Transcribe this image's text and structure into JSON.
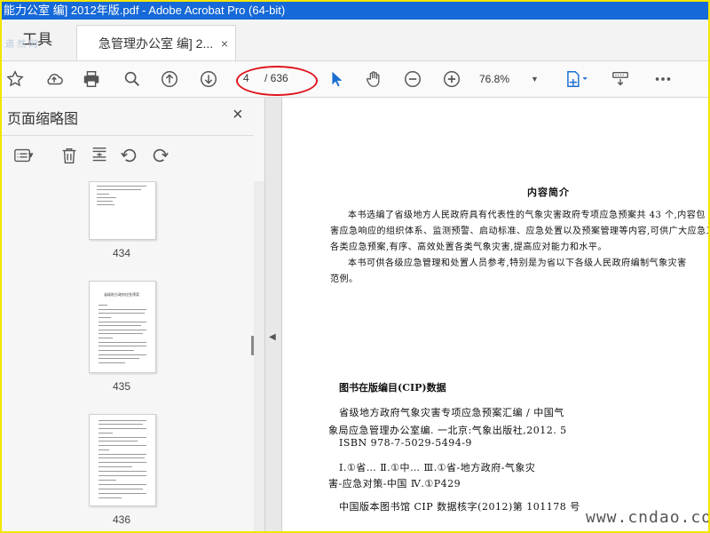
{
  "window": {
    "title": "能力公室 编] 2012年版.pdf - Adobe Acrobat Pro (64-bit)"
  },
  "tabs": {
    "tools_label": "工具",
    "watermark": "道 然 网",
    "doc_tab_label": "急管理办公室 编] 2...",
    "doc_tab_close": "×"
  },
  "toolbar": {
    "page_current": "4",
    "page_total": "/ 636",
    "zoom": "76.8%",
    "zoom_caret": "▼"
  },
  "panel": {
    "title": "页面缩略图",
    "close": "×",
    "options_caret": "▾",
    "thumbnails": [
      {
        "label": "434",
        "heading": ""
      },
      {
        "label": "435",
        "heading": "省级地方政府应急预案"
      },
      {
        "label": "436",
        "heading": ""
      }
    ],
    "collapse_arrow": "◀"
  },
  "document": {
    "intro_title": "内容简介",
    "intro_lines": [
      "本书选编了省级地方人民政府具有代表性的气象灾害政府专项应急预案共 43 个,内容包",
      "害应急响应的组织体系、监测预警、启动标准、应急处置以及预案管理等内容,可供广大应急工",
      "各类应急预案,有序、高效处置各类气象灾害,提高应对能力和水平。",
      "本书可供各级应急管理和处置人员参考,特别是为省以下各级人民政府编制气象灾害",
      "范例。"
    ],
    "cip_title": "图书在版编目(CIP)数据",
    "cip_lines": [
      "省级地方政府气象灾害专项应急预案汇编 / 中国气",
      "象局应急管理办公室编. 一北京:气象出版社,2012. 5",
      "ISBN 978-7-5029-5494-9",
      "Ⅰ.①省…  Ⅱ.①中…  Ⅲ.①省-地方政府-气象灾",
      "害-应急对策-中国  Ⅳ.①P429",
      "中国版本图书馆 CIP 数据核字(2012)第 101178 号"
    ]
  },
  "site_watermark": "www.cndao.com",
  "colors": {
    "titlebar": "#1669d8",
    "frame": "#f2e600",
    "annotation": "#e0141e",
    "select_tool": "#1a6fd1"
  }
}
